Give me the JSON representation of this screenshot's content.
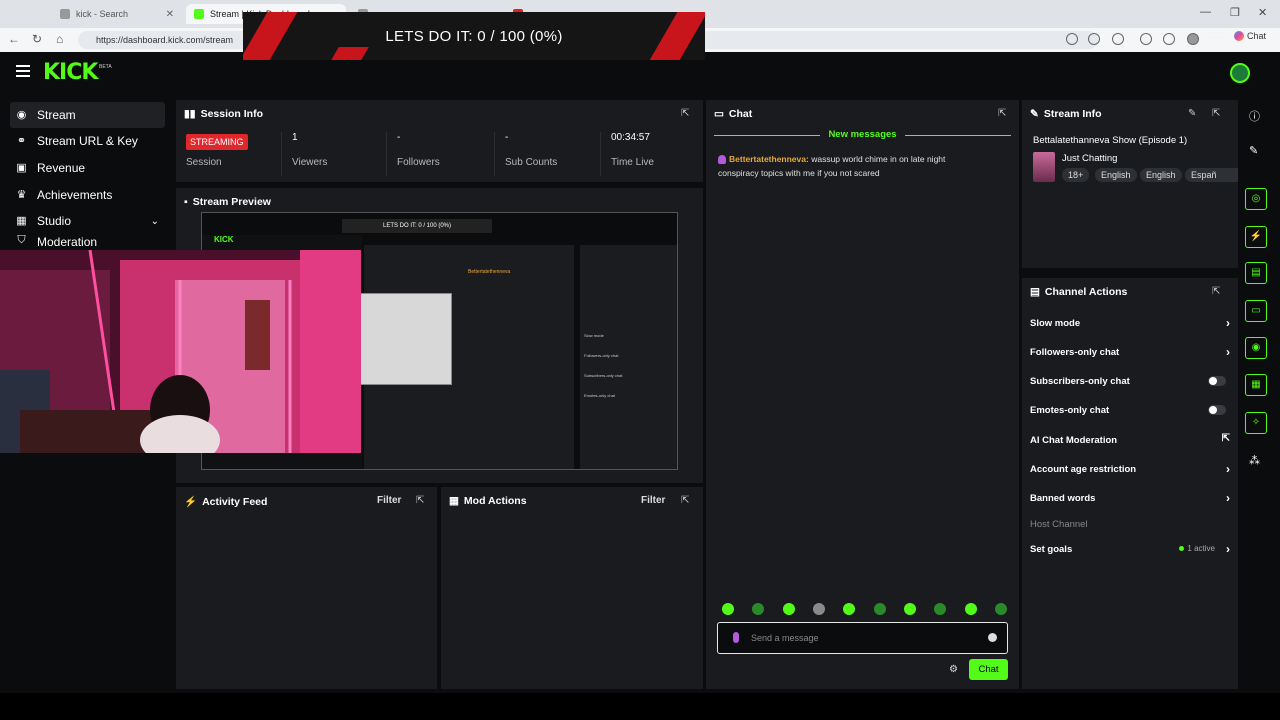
{
  "browser": {
    "tabs": [
      {
        "label": "kick - Search",
        "active": false
      },
      {
        "label": "Stream | Kick Dashboard",
        "active": true
      },
      {
        "label": "",
        "active": false
      },
      {
        "label": "",
        "active": false
      }
    ],
    "url": "https://dashboard.kick.com/stream",
    "chat_label": "Chat"
  },
  "goal_overlay": "LETS DO IT: 0 / 100 (0%)",
  "app": {
    "logo": "KICK",
    "beta": "BETA"
  },
  "sidebar": {
    "items": [
      {
        "label": "Stream",
        "icon": "broadcast-icon"
      },
      {
        "label": "Stream URL & Key",
        "icon": "link-icon"
      },
      {
        "label": "Revenue",
        "icon": "money-icon"
      },
      {
        "label": "Achievements",
        "icon": "trophy-icon"
      },
      {
        "label": "Studio",
        "icon": "studio-icon"
      },
      {
        "label": "Moderation",
        "icon": "shield-icon"
      }
    ]
  },
  "session": {
    "title": "Session Info",
    "status": "STREAMING",
    "status_label": "Session",
    "viewers": {
      "value": "1",
      "label": "Viewers"
    },
    "followers": {
      "value": "-",
      "label": "Followers"
    },
    "subs": {
      "value": "-",
      "label": "Sub Counts"
    },
    "time": {
      "value": "00:34:57",
      "label": "Time Live"
    }
  },
  "preview": {
    "title": "Stream Preview",
    "goal_text": "LETS DO IT: 0 / 100 (0%)"
  },
  "activity": {
    "title": "Activity Feed",
    "filter": "Filter"
  },
  "mod_actions": {
    "title": "Mod Actions",
    "filter": "Filter"
  },
  "chat": {
    "title": "Chat",
    "new_messages": "New messages",
    "message": {
      "user": "Bettertatethenneva",
      "text": "wassup world chime in on late night conspiracy topics with me if you not scared"
    },
    "input_placeholder": "Send a message",
    "send_label": "Chat"
  },
  "stream_info": {
    "title": "Stream Info",
    "stream_title": "Bettalatethanneva Show (Episode 1)",
    "category": "Just Chatting",
    "tags": [
      "18+",
      "English",
      "English",
      "Españ"
    ]
  },
  "channel_actions": {
    "title": "Channel Actions",
    "items": [
      {
        "label": "Slow mode",
        "control": "chevron"
      },
      {
        "label": "Followers-only chat",
        "control": "chevron"
      },
      {
        "label": "Subscribers-only chat",
        "control": "toggle"
      },
      {
        "label": "Emotes-only chat",
        "control": "toggle"
      },
      {
        "label": "AI Chat Moderation",
        "control": "external"
      },
      {
        "label": "Account age restriction",
        "control": "chevron"
      },
      {
        "label": "Banned words",
        "control": "chevron"
      },
      {
        "label": "Host Channel",
        "control": "none"
      },
      {
        "label": "Set goals",
        "control": "chevron"
      }
    ],
    "goals_active": "1 active"
  },
  "colors": {
    "accent": "#53fc18",
    "live": "#e0272b",
    "panel": "#191b1f",
    "bg": "#0b0c0d"
  }
}
